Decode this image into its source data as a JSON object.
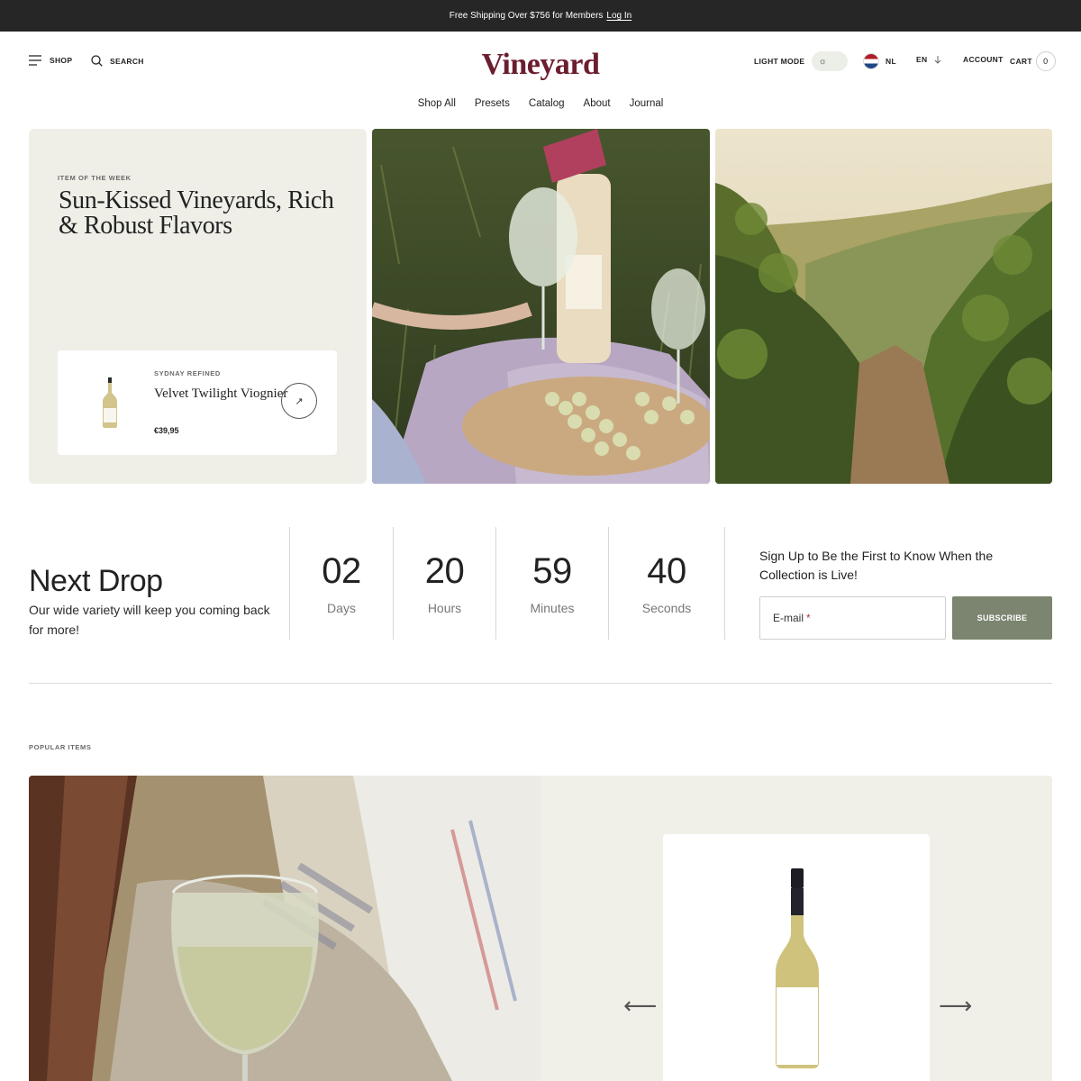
{
  "announcement": {
    "text": "Free Shipping Over $756 for Members",
    "link": "Log In"
  },
  "header": {
    "shop_label": "SHOP",
    "search_label": "SEARCH",
    "logo": "Vineyard",
    "light_mode_label": "LIGHT MODE",
    "country": "NL",
    "language": "EN",
    "account_label": "ACCOUNT",
    "cart_label": "CART",
    "cart_count": "0"
  },
  "nav": [
    "Shop All",
    "Presets",
    "Catalog",
    "About",
    "Journal"
  ],
  "hero": {
    "eyebrow": "ITEM OF THE WEEK",
    "title": "Sun-Kissed Vineyards, Rich & Robust Flavors",
    "product": {
      "brand": "SYDNAY REFINED",
      "name": "Velvet Twilight Viognier",
      "price": "€39,95"
    }
  },
  "drop": {
    "title": "Next Drop",
    "subtitle": "Our wide variety will keep you coming back for more!",
    "countdown": [
      {
        "value": "02",
        "label": "Days"
      },
      {
        "value": "20",
        "label": "Hours"
      },
      {
        "value": "59",
        "label": "Minutes"
      },
      {
        "value": "40",
        "label": "Seconds"
      }
    ],
    "signup_text": "Sign Up to Be the First to Know When the Collection is Live!",
    "email_placeholder": "E-mail",
    "subscribe_label": "SUBSCRIBE"
  },
  "popular": {
    "label": "POPULAR ITEMS"
  },
  "colors": {
    "brand": "#6b1e2e",
    "accent": "#7c8570",
    "panel": "#efefe8",
    "announcement_bg": "#262626"
  }
}
